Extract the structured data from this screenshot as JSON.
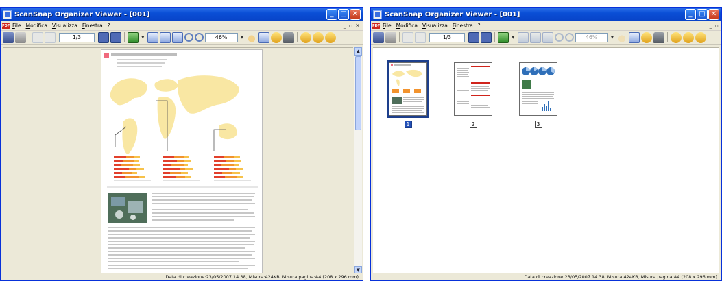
{
  "windows": [
    {
      "title": "ScanSnap Organizer Viewer - [001]",
      "menu": [
        "File",
        "Modifica",
        "Visualizza",
        "Finestra",
        "?"
      ],
      "page_indicator": "1/3",
      "zoom": "46%",
      "status": "Data di creazione:23/05/2007 14.38, Misura:424KB, Misura pagina:A4 (208 x 296 mm)"
    },
    {
      "title": "ScanSnap Organizer Viewer - [001]",
      "menu": [
        "File",
        "Modifica",
        "Visualizza",
        "Finestra",
        "?"
      ],
      "page_indicator": "1/3",
      "zoom": "46%",
      "status": "Data di creazione:23/05/2007 14.38, Misura:424KB, Misura pagina:A4 (208 x 296 mm)",
      "thumbnails": [
        {
          "number": "1",
          "selected": true
        },
        {
          "number": "2",
          "selected": false
        },
        {
          "number": "3",
          "selected": false
        }
      ]
    }
  ],
  "colors": {
    "titlebar": "#0a4fd6",
    "selection": "#1d3f8c",
    "map_fill": "#f9e7a3",
    "bar_red": "#e2402c",
    "bar_orange": "#f2932e",
    "bar_yellow": "#f7c24a",
    "accent_square": "#f06a7d"
  }
}
